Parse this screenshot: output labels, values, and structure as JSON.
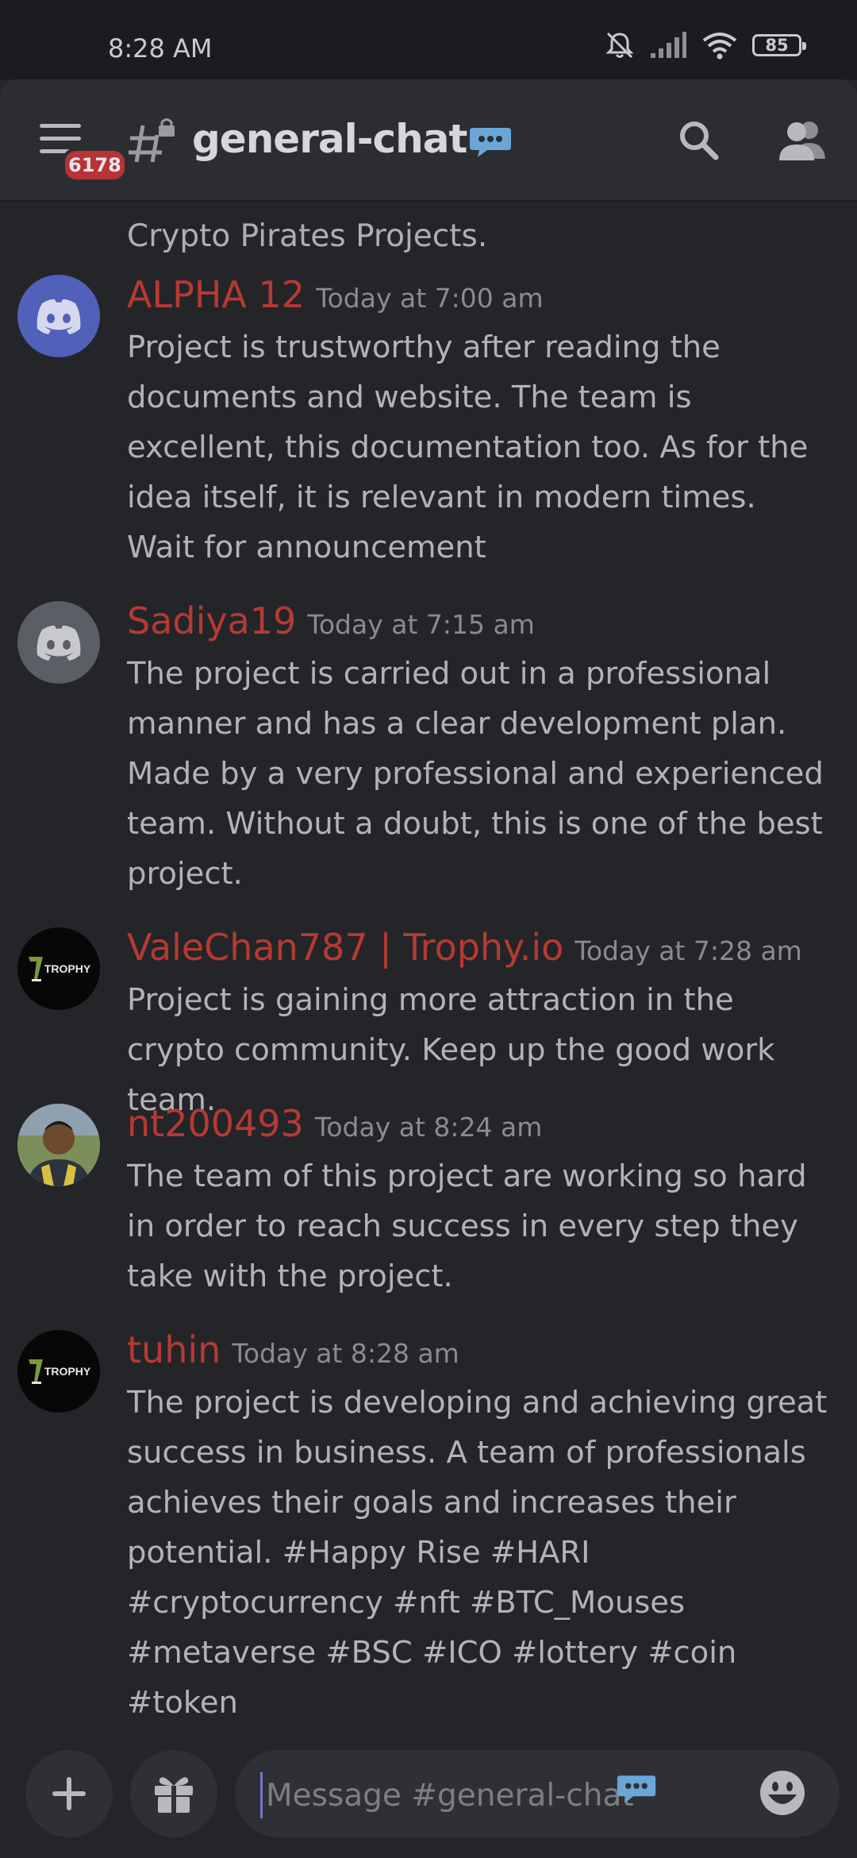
{
  "status": {
    "time": "8:28 AM",
    "battery": "85"
  },
  "header": {
    "badge": "6178",
    "channel": "general-chat"
  },
  "messages_prev": "Crypto Pirates Projects.",
  "messages": [
    {
      "user": "ALPHA 12",
      "time": "Today at 7:00 am",
      "avatar": "discord-blue",
      "text": "Project is trustworthy after reading the documents and website. The team is excellent, this documentation too. As for the idea itself, it is relevant in modern times. Wait for announcement"
    },
    {
      "user": "Sadiya19",
      "time": "Today at 7:15 am",
      "avatar": "discord-gray",
      "text": "The project is carried out in a professional manner and has a clear development plan. Made by a very professional and experienced team. Without a doubt, this is one of the best project."
    },
    {
      "user": "ValeChan787 | Trophy.io",
      "time": "Today at 7:28 am",
      "avatar": "trophy",
      "avatar_text": "TROPHY",
      "text": "Project is gaining more attraction in the crypto community. Keep up the good work team."
    },
    {
      "user": "nt200493",
      "time": "Today at 8:24 am",
      "avatar": "photo",
      "text": "The team of this project are working so hard in order to reach success in every step they take with the project."
    },
    {
      "user": "tuhin",
      "time": "Today at 8:28 am",
      "avatar": "trophy",
      "avatar_text": "TROPHY",
      "text": "The project is developing and achieving great success in business. A team of professionals achieves their goals and increases their potential. #Happy Rise #HARI #cryptocurrency #nft #BTC_Mouses #metaverse #BSC #ICO #lottery #coin #token"
    }
  ],
  "composer": {
    "placeholder": "Message #general-chat"
  }
}
